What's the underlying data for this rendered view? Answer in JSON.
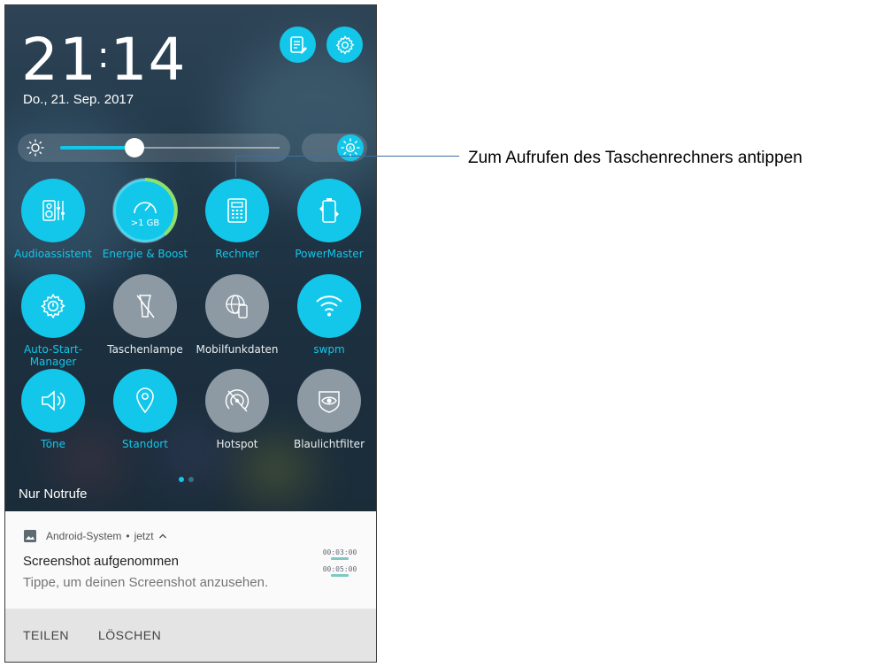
{
  "clock": {
    "hours": "21",
    "minutes": "14",
    "separator": ":"
  },
  "date": "Do., 21. Sep. 2017",
  "brightness": {
    "level": 0.34,
    "auto_enabled": true
  },
  "tiles": [
    {
      "label": "Audioassistent",
      "state": "on",
      "icon": "audio-wizard-icon"
    },
    {
      "label": "Energie & Boost",
      "state": "on",
      "icon": "speedometer-icon",
      "badge": ">1 GB"
    },
    {
      "label": "Rechner",
      "state": "on",
      "icon": "calculator-icon"
    },
    {
      "label": "PowerMaster",
      "state": "on",
      "icon": "battery-cycle-icon"
    },
    {
      "label": "Auto-Start-\nManager",
      "state": "on",
      "icon": "gear-power-icon"
    },
    {
      "label": "Taschenlampe",
      "state": "off",
      "icon": "flashlight-off-icon"
    },
    {
      "label": "Mobilfunkdaten",
      "state": "off",
      "icon": "globe-phone-icon"
    },
    {
      "label": "swpm",
      "state": "on",
      "icon": "wifi-icon"
    },
    {
      "label": "Töne",
      "state": "on",
      "icon": "speaker-icon"
    },
    {
      "label": "Standort",
      "state": "on",
      "icon": "location-pin-icon"
    },
    {
      "label": "Hotspot",
      "state": "off",
      "icon": "hotspot-off-icon"
    },
    {
      "label": "Blaulichtfilter",
      "state": "off",
      "icon": "eye-filter-icon"
    }
  ],
  "emergency_text": "Nur Notrufe",
  "notification": {
    "app": "Android-System",
    "separator": "•",
    "time": "jetzt",
    "title": "Screenshot aufgenommen",
    "text": "Tippe, um deinen Screenshot anzusehen.",
    "thumb_times": [
      "00:03:00",
      "00:05:00"
    ]
  },
  "actions": {
    "share": "TEILEN",
    "delete": "LÖSCHEN"
  },
  "callout": "Zum Aufrufen des Taschenrechners antippen",
  "colors": {
    "accent": "#12c7ea",
    "tile_off": "#8d9aa3",
    "callout_line": "#3c6fa0"
  }
}
